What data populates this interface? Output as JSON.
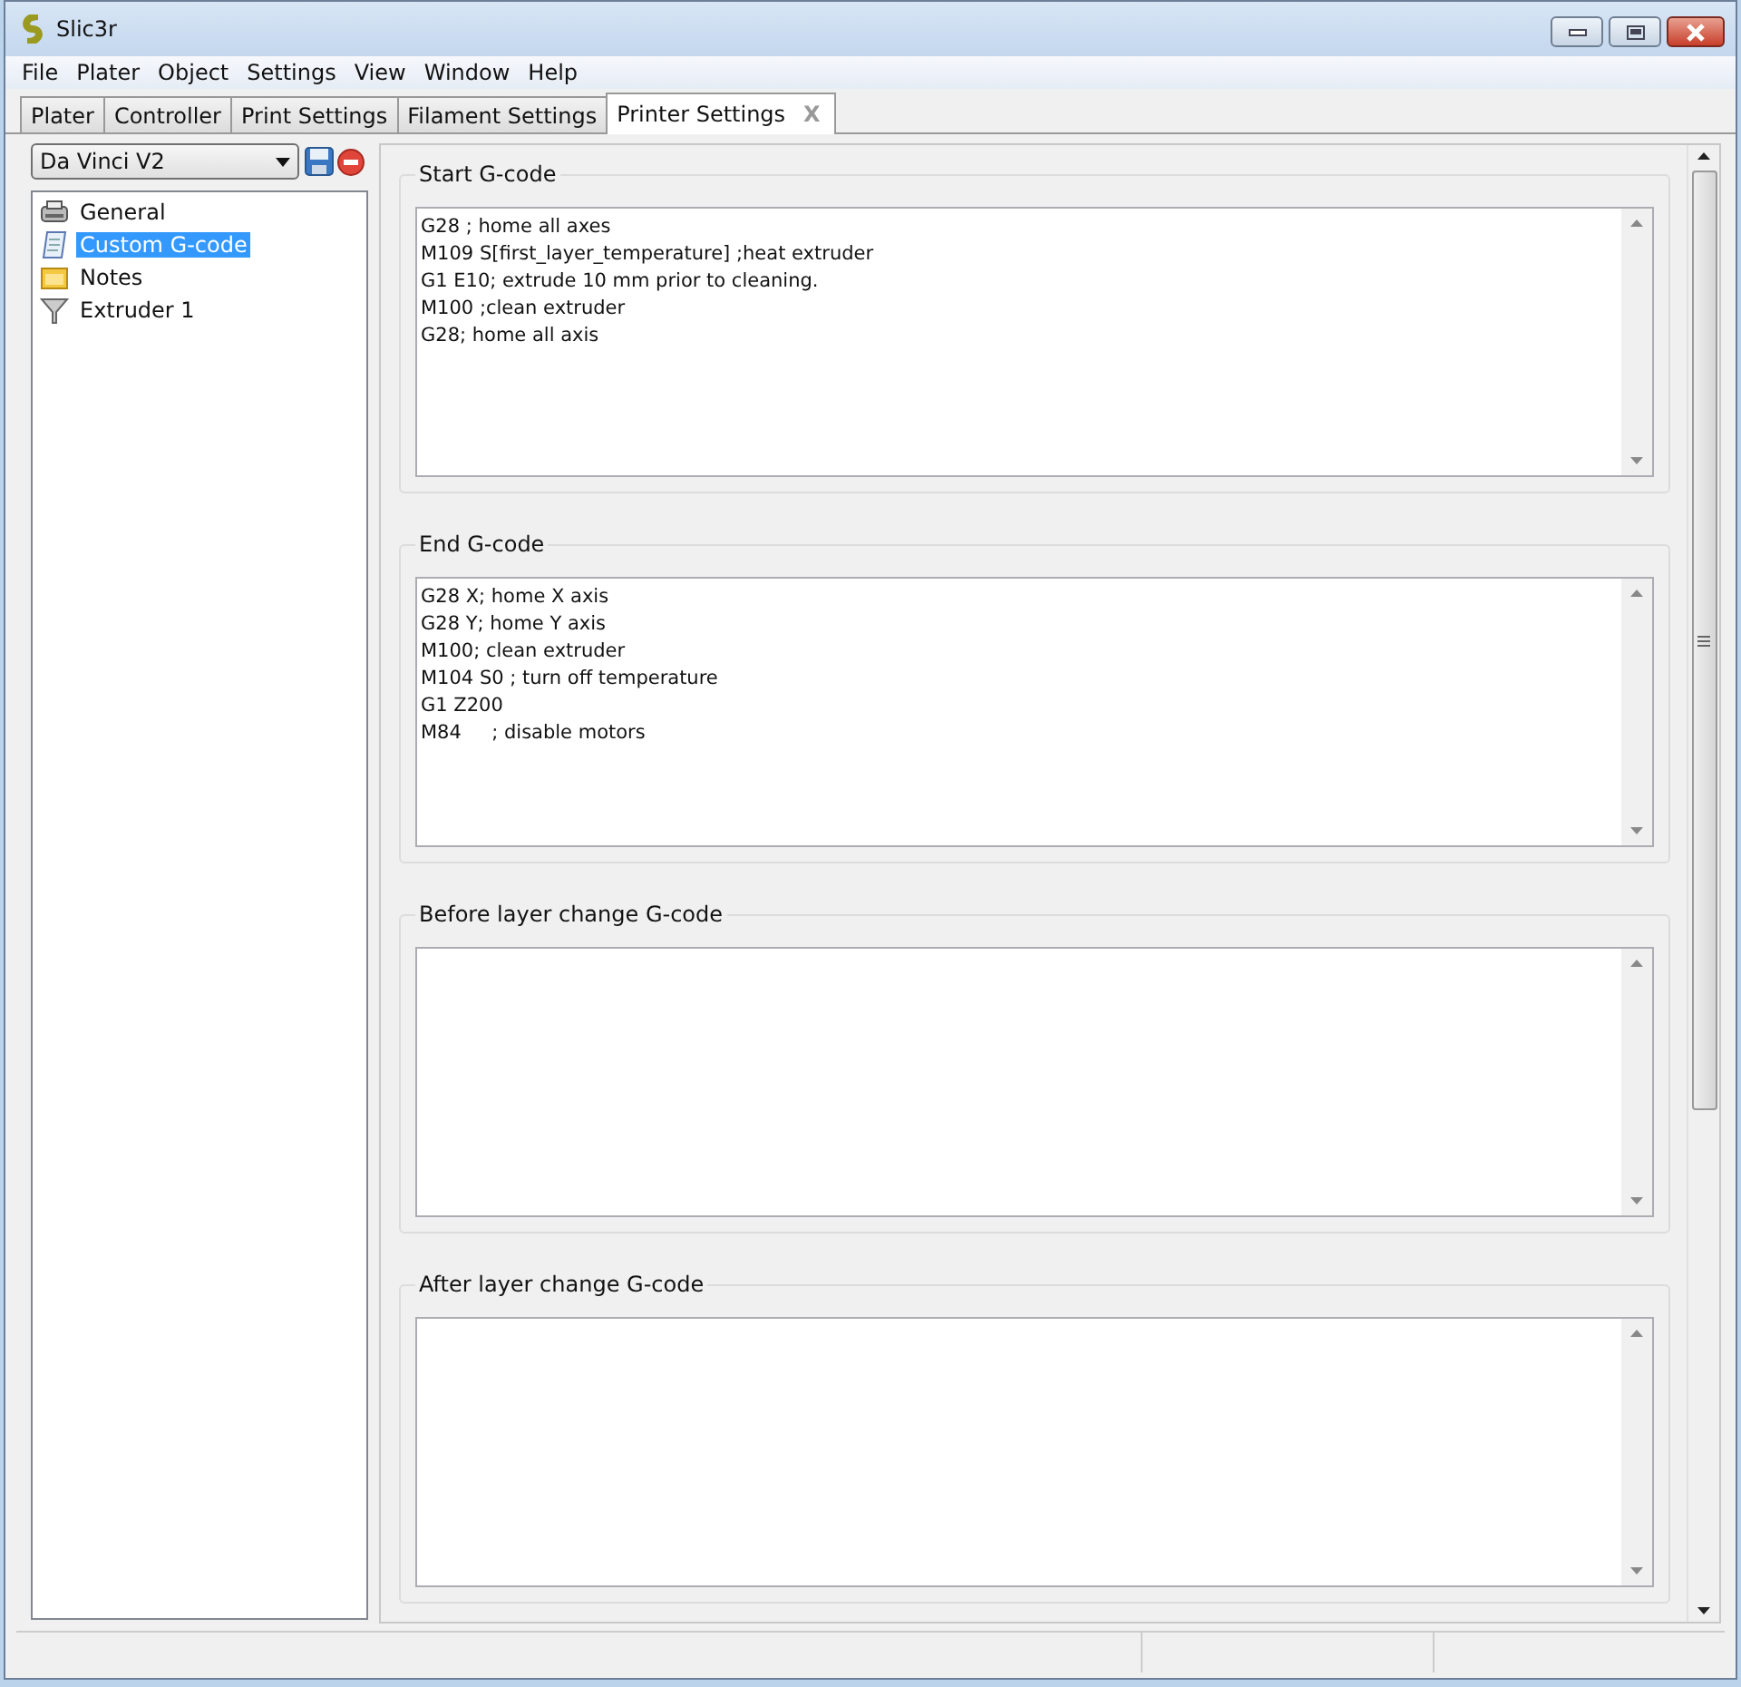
{
  "window": {
    "title": "Slic3r"
  },
  "menu": [
    "File",
    "Plater",
    "Object",
    "Settings",
    "View",
    "Window",
    "Help"
  ],
  "tabs": [
    {
      "label": "Plater",
      "selected": false
    },
    {
      "label": "Controller",
      "selected": false
    },
    {
      "label": "Print Settings",
      "selected": false
    },
    {
      "label": "Filament Settings",
      "selected": false
    },
    {
      "label": "Printer Settings",
      "selected": true,
      "close": "X"
    }
  ],
  "preset": {
    "value": "Da Vinci V2"
  },
  "tree": [
    {
      "label": "General",
      "kind": "printer",
      "selected": false
    },
    {
      "label": "Custom G-code",
      "kind": "script",
      "selected": true
    },
    {
      "label": "Notes",
      "kind": "note",
      "selected": false
    },
    {
      "label": "Extruder 1",
      "kind": "extruder",
      "selected": false
    }
  ],
  "sections": [
    {
      "title": "Start G-code",
      "lines": [
        "G28 ; home all axes",
        "M109 S[first_layer_temperature] ;heat extruder",
        "G1 E10; extrude 10 mm prior to cleaning.",
        "M100 ;clean extruder",
        "G28; home all axis"
      ]
    },
    {
      "title": "End G-code",
      "lines": [
        "G28 X; home X axis",
        "G28 Y; home Y axis",
        "M100; clean extruder",
        "M104 S0 ; turn off temperature",
        "G1 Z200",
        "M84     ; disable motors"
      ]
    },
    {
      "title": "Before layer change G-code"
    },
    {
      "title": "After layer change G-code"
    }
  ]
}
